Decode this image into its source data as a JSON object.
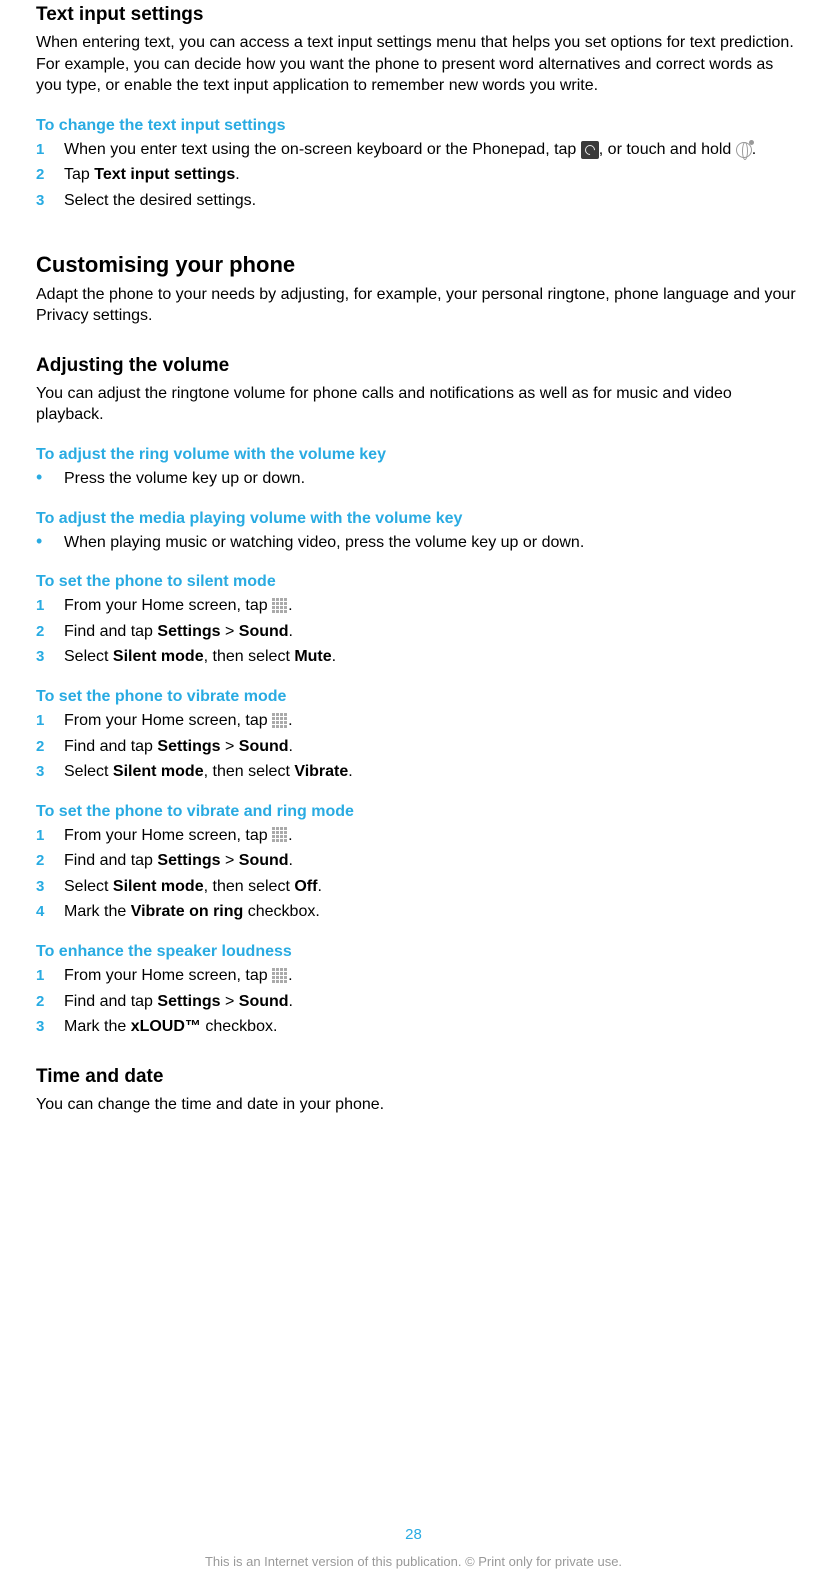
{
  "page_number": "28",
  "footer": "This is an Internet version of this publication. © Print only for private use.",
  "s1": {
    "title": "Text input settings",
    "para": "When entering text, you can access a text input settings menu that helps you set options for text prediction. For example, you can decide how you want the phone to present word alternatives and correct words as you type, or enable the text input application to remember new words you write.",
    "sub1": {
      "title": "To change the text input settings",
      "step1_a": "When you enter text using the on-screen keyboard or the Phonepad, tap ",
      "step1_b": ", or touch and hold ",
      "step1_c": ".",
      "step2_a": "Tap ",
      "step2_b": "Text input settings",
      "step2_c": ".",
      "step3": "Select the desired settings."
    }
  },
  "s2": {
    "title": "Customising your phone",
    "para": "Adapt the phone to your needs by adjusting, for example, your personal ringtone, phone language and your Privacy settings."
  },
  "s3": {
    "title": "Adjusting the volume",
    "para": "You can adjust the ringtone volume for phone calls and notifications as well as for music and video playback.",
    "sub1": {
      "title": "To adjust the ring volume with the volume key",
      "bullet": "Press the volume key up or down."
    },
    "sub2": {
      "title": "To adjust the media playing volume with the volume key",
      "bullet": "When playing music or watching video, press the volume key up or down."
    },
    "sub3": {
      "title": "To set the phone to silent mode",
      "step1": "From your Home screen, tap ",
      "step2_a": "Find and tap ",
      "step2_b": "Settings",
      "step2_c": " > ",
      "step2_d": "Sound",
      "step2_e": ".",
      "step3_a": "Select ",
      "step3_b": "Silent mode",
      "step3_c": ", then select ",
      "step3_d": "Mute",
      "step3_e": "."
    },
    "sub4": {
      "title": "To set the phone to vibrate mode",
      "step1": "From your Home screen, tap ",
      "step2_a": "Find and tap ",
      "step2_b": "Settings",
      "step2_c": " > ",
      "step2_d": "Sound",
      "step2_e": ".",
      "step3_a": "Select ",
      "step3_b": "Silent mode",
      "step3_c": ", then select ",
      "step3_d": "Vibrate",
      "step3_e": "."
    },
    "sub5": {
      "title": "To set the phone to vibrate and ring mode",
      "step1": "From your Home screen, tap ",
      "step2_a": "Find and tap ",
      "step2_b": "Settings",
      "step2_c": " > ",
      "step2_d": "Sound",
      "step2_e": ".",
      "step3_a": "Select ",
      "step3_b": "Silent mode",
      "step3_c": ", then select ",
      "step3_d": "Off",
      "step3_e": ".",
      "step4_a": "Mark the ",
      "step4_b": "Vibrate on ring",
      "step4_c": " checkbox."
    },
    "sub6": {
      "title": "To enhance the speaker loudness",
      "step1": "From your Home screen, tap ",
      "step2_a": "Find and tap ",
      "step2_b": "Settings",
      "step2_c": " > ",
      "step2_d": "Sound",
      "step2_e": ".",
      "step3_a": "Mark the ",
      "step3_b": "xLOUD™",
      "step3_c": " checkbox."
    }
  },
  "s4": {
    "title": "Time and date",
    "para": "You can change the time and date in your phone."
  },
  "nums": {
    "n1": "1",
    "n2": "2",
    "n3": "3",
    "n4": "4",
    "dot": "•"
  }
}
